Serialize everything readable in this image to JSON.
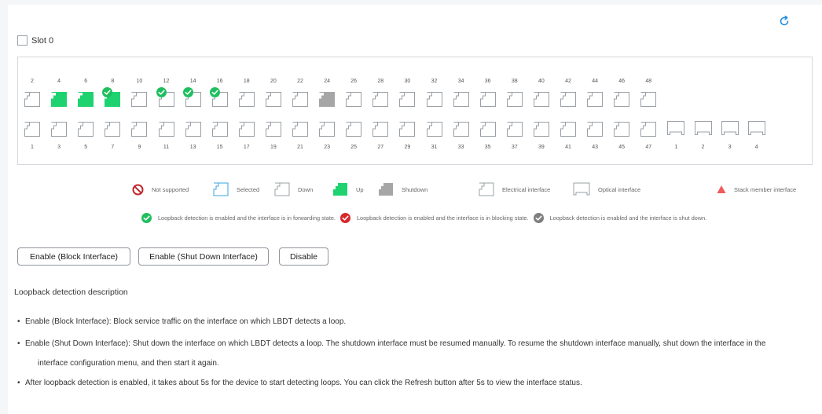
{
  "slot": {
    "label": "Slot 0"
  },
  "ports": {
    "top_labels": [
      "2",
      "4",
      "6",
      "8",
      "10",
      "12",
      "14",
      "16",
      "18",
      "20",
      "22",
      "24",
      "26",
      "28",
      "30",
      "32",
      "34",
      "36",
      "38",
      "40",
      "42",
      "44",
      "46",
      "48"
    ],
    "top_states": [
      "down",
      "up",
      "up",
      "up",
      "down",
      "down",
      "down",
      "down",
      "down",
      "down",
      "down",
      "shutdown",
      "down",
      "down",
      "down",
      "down",
      "down",
      "down",
      "down",
      "down",
      "down",
      "down",
      "down",
      "down"
    ],
    "top_loopback": [
      "",
      "",
      "",
      "enabled-forwarding",
      "",
      "enabled-forwarding",
      "enabled-forwarding",
      "enabled-forwarding",
      "",
      "",
      "",
      "",
      "",
      "",
      "",
      "",
      "",
      "",
      "",
      "",
      "",
      "",
      "",
      ""
    ],
    "bottom_labels": [
      "1",
      "3",
      "5",
      "7",
      "9",
      "11",
      "13",
      "15",
      "17",
      "19",
      "21",
      "23",
      "25",
      "27",
      "29",
      "31",
      "33",
      "35",
      "37",
      "39",
      "41",
      "43",
      "45",
      "47"
    ],
    "optical_labels": [
      "1",
      "2",
      "3",
      "4"
    ]
  },
  "legend": {
    "not_supported": "Not supported",
    "selected": "Selected",
    "down": "Down",
    "up": "Up",
    "shutdown": "Shutdown",
    "electrical": "Electrical interface",
    "optical": "Optical interface",
    "stack": "Stack member interface",
    "lb_forwarding": "Loopback detection is enabled and the interface is in forwarding state.",
    "lb_blocking": "Loopback detection is enabled and the interface is in blocking state.",
    "lb_shutdown": "Loopback detection is enabled and the interface is shut down."
  },
  "buttons": {
    "enable_block": "Enable (Block Interface)",
    "enable_shutdown": "Enable (Shut Down Interface)",
    "disable": "Disable"
  },
  "description": {
    "title": "Loopback detection description",
    "item1": "Enable (Block Interface): Block service traffic on the interface on which LBDT detects a loop.",
    "item2a": "Enable (Shut Down Interface): Shut down the interface on which LBDT detects a loop. The shutdown interface must be resumed manually. To resume the shutdown interface manually, shut down the interface in the",
    "item2b": "interface configuration menu, and then start it again.",
    "item3": "After loopback detection is enabled, it takes about 5s for the device to start detecting loops. You can click the Refresh button after 5s to view the interface status."
  },
  "colors": {
    "up": "#1ed36f",
    "shutdown": "#a6a6a6",
    "down_stroke": "#9aa0a6",
    "selected_stroke": "#3aa3e3",
    "forwarding": "#1fbf5f",
    "blocking": "#d9262a",
    "shut_check": "#7f7f7f",
    "refresh": "#1f8de0",
    "stack": "#f05a5a",
    "not_supported": "#c0292e"
  }
}
